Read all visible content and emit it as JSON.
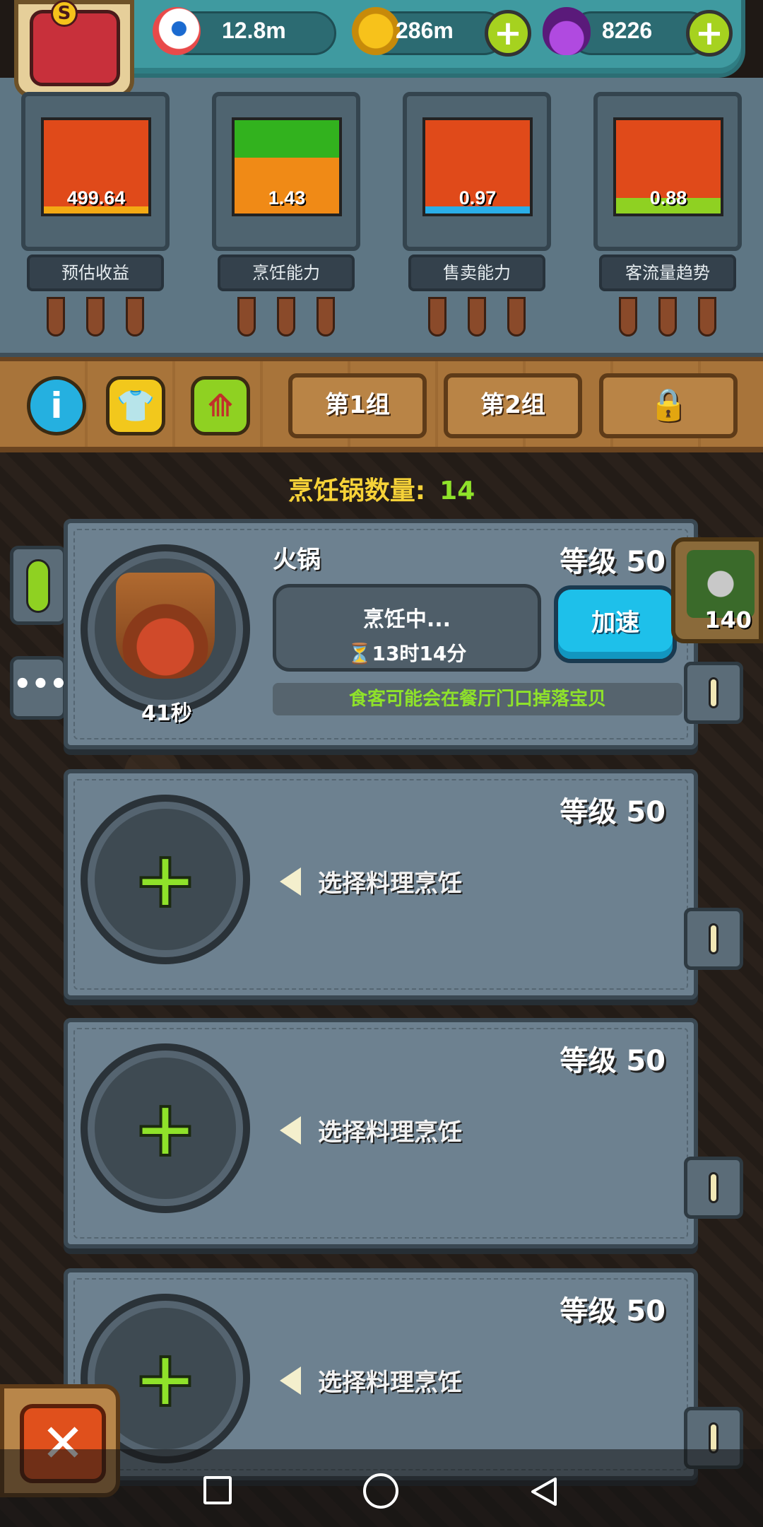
{
  "resources": {
    "eyeball": {
      "value": "12.8m",
      "icon": "eyeball-icon"
    },
    "coins": {
      "value": "286m",
      "icon": "coin-icon"
    },
    "potion": {
      "value": "8226",
      "icon": "potion-icon"
    }
  },
  "stats": [
    {
      "label": "预估收益",
      "value": "499.64"
    },
    {
      "label": "烹饪能力",
      "value": "1.43"
    },
    {
      "label": "售卖能力",
      "value": "0.97"
    },
    {
      "label": "客流量趋势",
      "value": "0.88"
    }
  ],
  "toolbar": {
    "group1": "第1组",
    "group2": "第2组"
  },
  "pot_count": {
    "label": "烹饪锅数量:",
    "value": "14"
  },
  "stoves": [
    {
      "dish": "火锅",
      "level": "等级 50",
      "status": "烹饪中...",
      "remaining": "⏳13时14分",
      "speed_up": "加速",
      "tip": "食客可能会在餐厅门口掉落宝贝",
      "timer": "41秒",
      "reward_count": "140"
    },
    {
      "level": "等级 50",
      "hint": "选择料理烹饪"
    },
    {
      "level": "等级 50",
      "hint": "选择料理烹饪"
    },
    {
      "level": "等级 50",
      "hint": "选择料理烹饪"
    }
  ],
  "colors": {
    "accent_green": "#8fe22a",
    "speed_blue": "#1ec0ea",
    "title_yellow": "#f6d238"
  }
}
